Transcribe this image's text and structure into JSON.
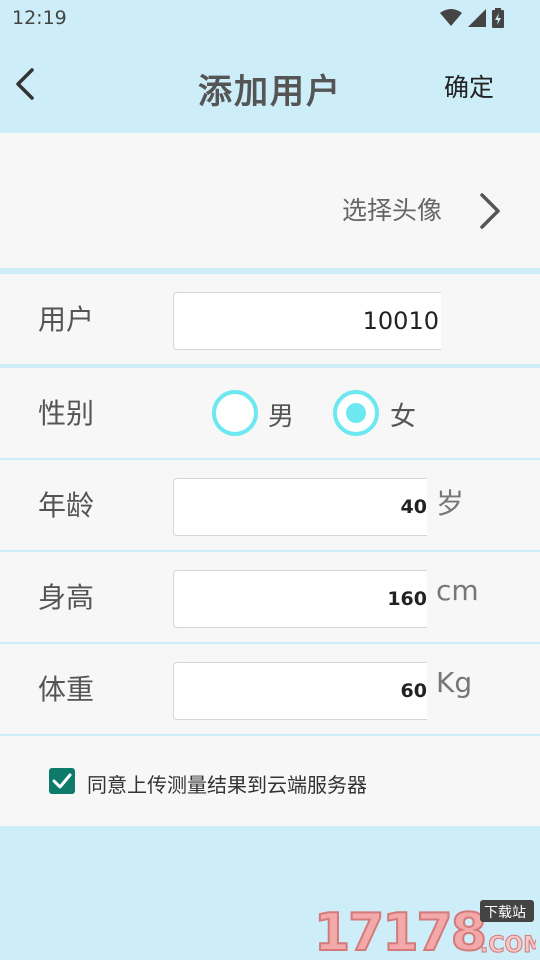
{
  "status": {
    "time": "12:19"
  },
  "header": {
    "title": "添加用户",
    "confirm_label": "确定"
  },
  "avatar": {
    "label": "选择头像"
  },
  "form": {
    "user": {
      "label": "用户",
      "value": "10010"
    },
    "gender": {
      "label": "性别",
      "options": [
        "男",
        "女"
      ],
      "selected": "女"
    },
    "age": {
      "label": "年龄",
      "value": "40",
      "unit": "岁"
    },
    "height": {
      "label": "身高",
      "value": "160",
      "unit": "cm"
    },
    "weight": {
      "label": "体重",
      "value": "60",
      "unit": "Kg"
    }
  },
  "agree": {
    "checked": true,
    "text": "同意上传测量结果到云端服务器"
  },
  "watermark": {
    "main": "17178",
    "badge": "下载站",
    "suffix": ".COM"
  },
  "colors": {
    "background": "#cdeef8",
    "accent": "#6ee8f0",
    "checkbox": "#0e7a6a"
  }
}
